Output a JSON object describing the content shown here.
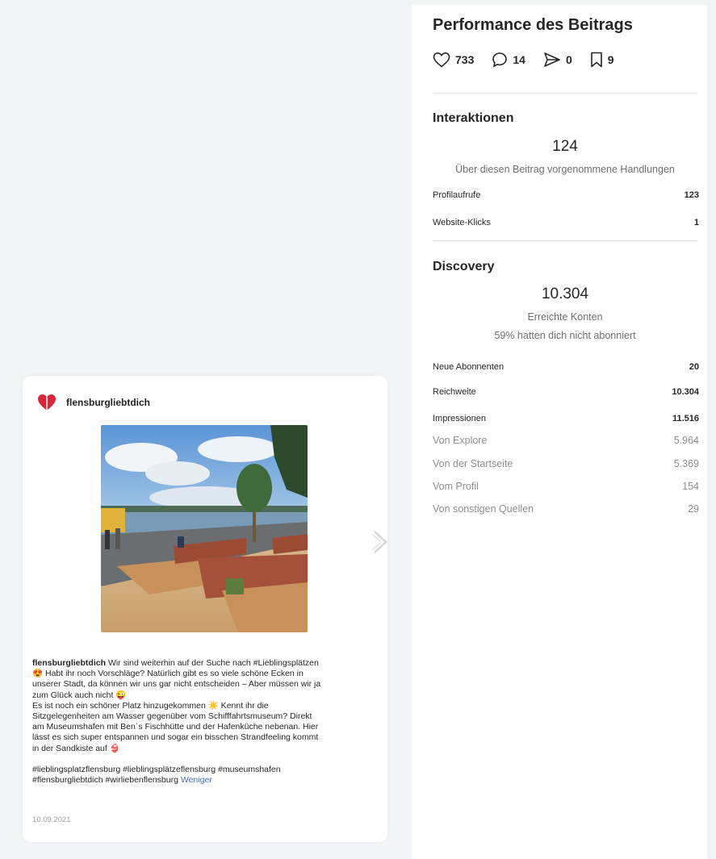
{
  "post": {
    "username": "flensburgliebtdich",
    "caption_user": "flensburgliebtdich",
    "caption_lines": [
      "Wir sind weiterhin auf der Suche nach #Lieblingsplätzen",
      "😍 Habt ihr noch Vorschläge? Natürlich gibt es so viele schöne Ecken in",
      "unserer Stadt, da können wir uns gar nicht entscheiden – Aber müssen wir ja",
      "zum Glück auch nicht 😜",
      "Es ist noch ein schöner Platz hinzugekommen ☀️ Kennt ihr die",
      "Sitzgelegenheiten am Wasser gegenüber vom Schifffahrtsmuseum? Direkt",
      "am Museumshafen mit Ben`s Fischhütte und der Hafenküche nebenan. Hier",
      "lässt es sich super entspannen und sogar ein bisschen Strandfeeling kommt",
      "in der Sandkiste auf 👙"
    ],
    "hashtags_line1": "#lieblingsplatzflensburg #lieblingsplätzeflensburg #museumshafen",
    "hashtags_line2": "#flensburgliebtdich #wirliebenflensburg",
    "less_label": "Weniger",
    "date": "10.09.2021",
    "logo_icon": "heart-logo-icon",
    "next_icon": "chevron-right-icon"
  },
  "performance": {
    "title": "Performance des Beitrags",
    "likes": "733",
    "comments": "14",
    "shares": "0",
    "saves": "9",
    "icons": [
      "heart-icon",
      "comment-icon",
      "send-icon",
      "bookmark-icon"
    ]
  },
  "interactions": {
    "title": "Interaktionen",
    "total": "124",
    "subtitle": "Über diesen Beitrag vorgenommene Handlungen",
    "rows": [
      {
        "label": "Profilaufrufe",
        "value": "123"
      },
      {
        "label": "Website-Klicks",
        "value": "1"
      }
    ]
  },
  "discovery": {
    "title": "Discovery",
    "total": "10.304",
    "subtitle1": "Erreichte Konten",
    "subtitle2": "59% hatten dich nicht abonniert",
    "rows": [
      {
        "label": "Neue Abonnenten",
        "value": "20"
      },
      {
        "label": "Reichweite",
        "value": "10.304"
      },
      {
        "label": "Impressionen",
        "value": "11.516"
      }
    ],
    "sources": [
      {
        "label": "Von Explore",
        "value": "5.964"
      },
      {
        "label": "Von der Startseite",
        "value": "5.369"
      },
      {
        "label": "Vom Profil",
        "value": "154"
      },
      {
        "label": "Von sonstigen Quellen",
        "value": "29"
      }
    ]
  }
}
